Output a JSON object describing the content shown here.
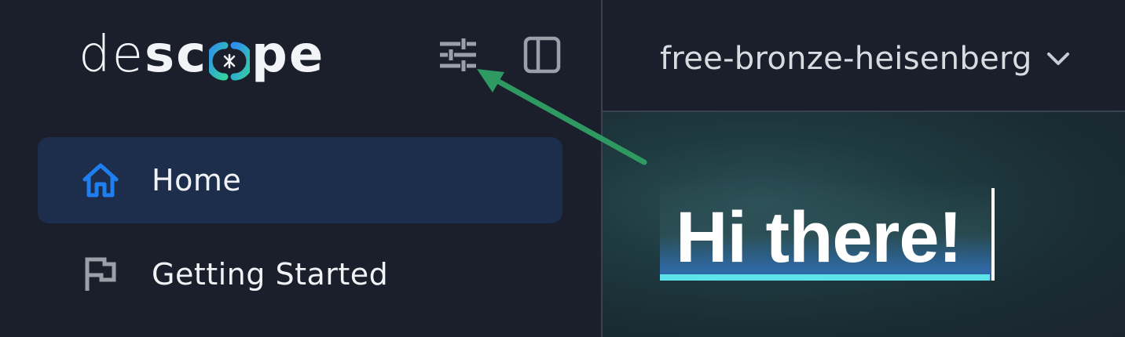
{
  "brand": {
    "logo_part1": "de",
    "logo_part2": "sc",
    "logo_part3": "pe",
    "logo_text": "descope"
  },
  "sidebar": {
    "customize_icon": "sliders-icon",
    "panel_toggle_icon": "panel-toggle-icon",
    "items": [
      {
        "label": "Home",
        "icon": "home-icon",
        "active": true
      },
      {
        "label": "Getting Started",
        "icon": "flag-icon",
        "active": false
      }
    ]
  },
  "topbar": {
    "project_name": "free-bronze-heisenberg",
    "dropdown_icon": "chevron-down-icon"
  },
  "main": {
    "greeting": "Hi there!"
  },
  "colors": {
    "background": "#1b1f2b",
    "active_item": "#1c2e4c",
    "accent_blue": "#1f7ff0",
    "highlight_cyan": "#5fe3ea",
    "annotation_green": "#2e9a62"
  }
}
